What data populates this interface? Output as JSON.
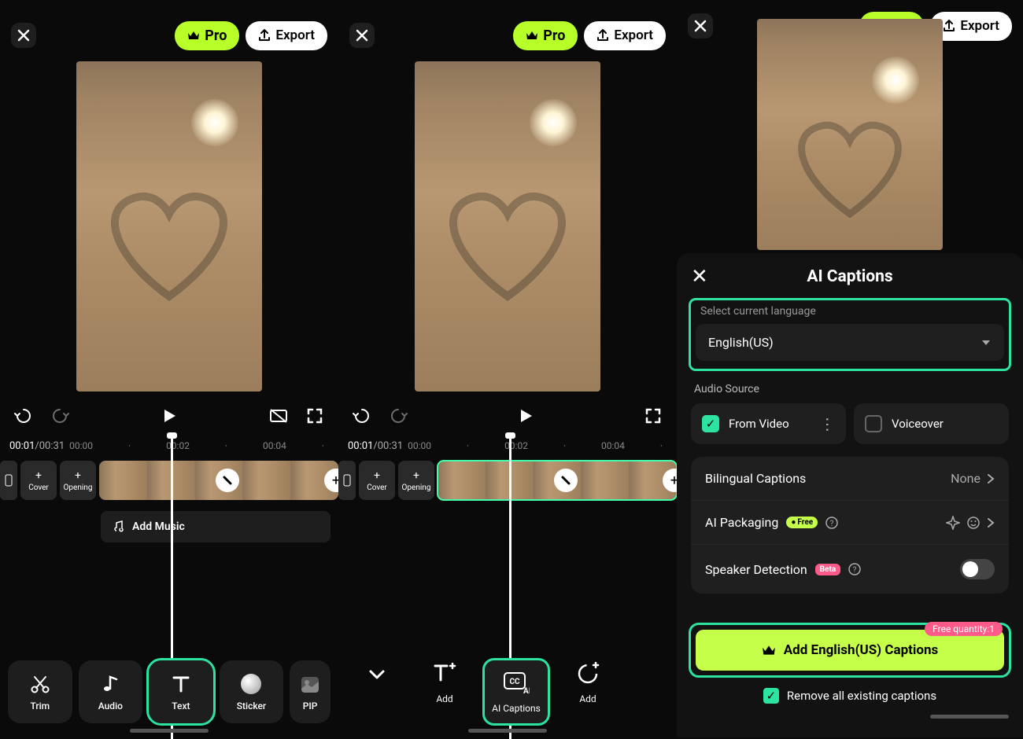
{
  "common": {
    "pro_label": "Pro",
    "export_label": "Export"
  },
  "timeline": {
    "current": "00:01",
    "total": "00:31",
    "ticks": [
      "00:00",
      "·",
      "00:02",
      "·",
      "00:04",
      "·"
    ],
    "cover_label": "Cover",
    "opening_label": "Opening",
    "add_music": "Add Music"
  },
  "panel1_tools": {
    "trim": "Trim",
    "audio": "Audio",
    "text": "Text",
    "sticker": "Sticker",
    "pip": "PIP"
  },
  "panel2_tools": {
    "add": "Add",
    "ai_captions": "AI Captions",
    "add2": "Add"
  },
  "modal": {
    "title": "AI Captions",
    "select_lang_label": "Select current language",
    "lang_value": "English(US)",
    "audio_source_label": "Audio Source",
    "from_video": "From Video",
    "voiceover": "Voiceover",
    "bilingual": "Bilingual Captions",
    "bilingual_value": "None",
    "ai_packaging": "AI Packaging",
    "ai_packaging_badge": "Free",
    "speaker_detection": "Speaker Detection",
    "speaker_badge": "Beta",
    "cta": "Add English(US) Captions",
    "free_quantity": "Free quantity:1",
    "remove_caps": "Remove all existing captions"
  }
}
